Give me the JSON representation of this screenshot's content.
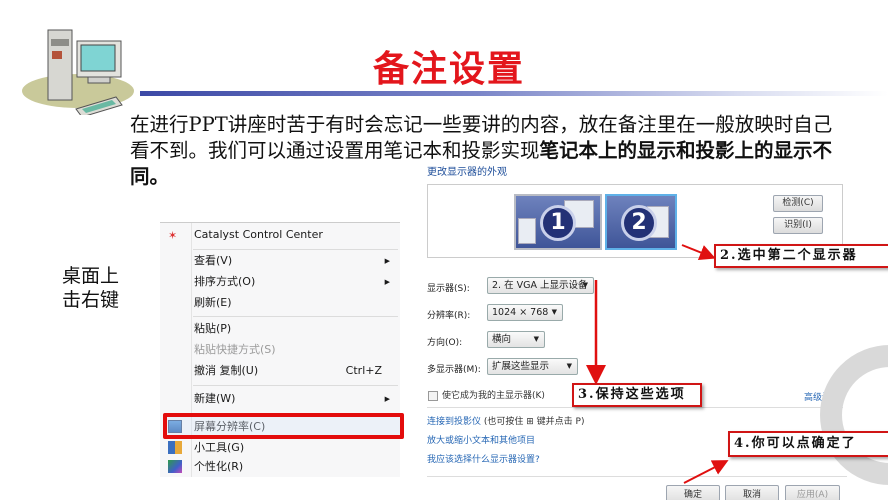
{
  "slide": {
    "title": "备注设置",
    "intro_normal": "在进行PPT讲座时苦于有时会忘记一些要讲的内容，放在备注里在一般放映时自己看不到。我们可以通过设置用笔记本和投影实现",
    "intro_bold": "笔记本上的显示和投影上的显示不同。",
    "side_label_line1": "桌面上",
    "side_label_line2": "击右键",
    "colors": {
      "title": "#e3161c",
      "highlight_border": "#e30c0c",
      "link": "#2868b5"
    }
  },
  "context_menu": {
    "items": [
      {
        "label": "Catalyst Control Center",
        "icon": "catalyst-icon"
      },
      {
        "label": "查看(V)",
        "submenu": true
      },
      {
        "label": "排序方式(O)",
        "submenu": true
      },
      {
        "label": "刷新(E)"
      },
      {
        "label": "粘贴(P)"
      },
      {
        "label": "粘贴快捷方式(S)",
        "disabled": true
      },
      {
        "label": "撤消 复制(U)",
        "shortcut": "Ctrl+Z"
      },
      {
        "label": "新建(W)",
        "submenu": true
      },
      {
        "label": "屏幕分辨率(C)",
        "icon": "screen-resolution-icon",
        "highlighted": true
      },
      {
        "label": "小工具(G)",
        "icon": "gadgets-icon"
      },
      {
        "label": "个性化(R)",
        "icon": "personalize-icon"
      }
    ],
    "submenu_arrow": "▶"
  },
  "display_settings": {
    "heading": "更改显示器的外观",
    "monitor_1": "1",
    "monitor_2": "2",
    "detect_button": "检测(C)",
    "identify_button": "识别(I)",
    "fields": [
      {
        "label": "显示器(S):",
        "value": "2. 在 VGA 上显示设备"
      },
      {
        "label": "分辨率(R):",
        "value": "1024 × 768"
      },
      {
        "label": "方向(O):",
        "value": "横向"
      },
      {
        "label": "多显示器(M):",
        "value": "扩展这些显示"
      }
    ],
    "primary_checkbox_label": "使它成为我的主显示器(K)",
    "primary_checked": false,
    "advanced_link": "高级设置",
    "links": [
      {
        "text": "连接到投影仪",
        "suffix": " (也可按住 ⊞ 键并点击 P)"
      },
      {
        "text": "放大或缩小文本和其他项目"
      },
      {
        "text": "我应该选择什么显示器设置?"
      }
    ],
    "ok_button": "确定",
    "cancel_button": "取消",
    "apply_button": "应用(A)"
  },
  "callouts": {
    "step2": "2.选中第二个显示器",
    "step3": "3.保持这些选项",
    "step4": "4.你可以点确定了"
  }
}
